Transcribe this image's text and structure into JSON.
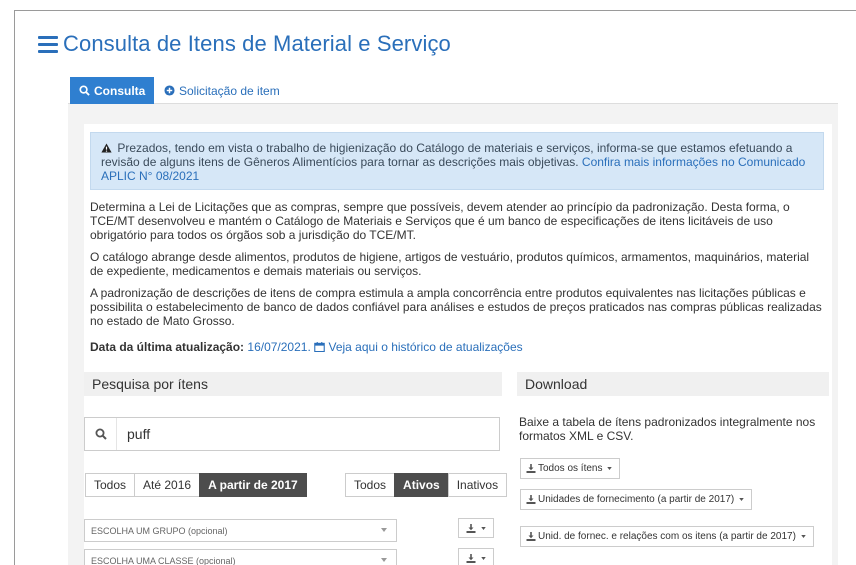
{
  "page": {
    "title": "Consulta de Itens de Material e Serviço"
  },
  "tabs": [
    {
      "label": "Consulta",
      "icon": "search-icon",
      "active": true
    },
    {
      "label": "Solicitação de item",
      "icon": "plus-circle-icon",
      "active": false
    }
  ],
  "alert": {
    "text": "Prezados, tendo em vista o trabalho de higienização do Catálogo de materiais e serviços, informa-se que estamos efetuando a revisão de alguns itens de Gêneros Alimentícios para tornar as descrições mais objetivas.",
    "link": "Confira mais informações no Comunicado APLIC N° 08/2021",
    "icon": "warning-icon"
  },
  "paragraphs": [
    "Determina a Lei de Licitações que as compras, sempre que possíveis, devem atender ao princípio da padronização. Desta forma, o TCE/MT desenvolveu e mantém o Catálogo de Materiais e Serviços que é um banco de especificações de itens licitáveis de uso obrigatório para todos os órgãos sob a jurisdição do TCE/MT.",
    "O catálogo abrange desde alimentos, produtos de higiene, artigos de vestuário, produtos químicos, armamentos, maquinários, material de expediente, medicamentos e demais materiais ou serviços.",
    "A padronização de descrições de itens de compra estimula a ampla concorrência entre produtos equivalentes nas licitações públicas e possibilita o estabelecimento de banco de dados confiável para análises e estudos de preços praticados nas compras públicas realizadas no estado de Mato Grosso."
  ],
  "update": {
    "label": "Data da última atualização:",
    "date": "16/07/2021.",
    "history_link": "Veja aqui o histórico de atualizações"
  },
  "search": {
    "heading": "Pesquisa por ítens",
    "value": "puff",
    "year_filters": [
      {
        "label": "Todos",
        "active": false
      },
      {
        "label": "Até 2016",
        "active": false
      },
      {
        "label": "A partir de 2017",
        "active": true
      }
    ],
    "status_filters": [
      {
        "label": "Todos",
        "active": false
      },
      {
        "label": "Ativos",
        "active": true
      },
      {
        "label": "Inativos",
        "active": false
      }
    ],
    "group_select": "ESCOLHA UM GRUPO (opcional)",
    "class_select": "ESCOLHA UMA CLASSE (opcional)"
  },
  "download": {
    "heading": "Download",
    "description": "Baixe a tabela de ítens padronizados integralmente nos formatos XML e CSV.",
    "buttons": [
      "Todos os ítens",
      "Unidades de fornecimento (a partir de 2017)",
      "Unid. de fornec. e relações com os itens (a partir de 2017)"
    ]
  },
  "colors": {
    "accent": "#2a6fba",
    "tab_active": "#2f7fd0",
    "alert_bg": "#d6e7f7",
    "toggle_on": "#4d4d4d"
  }
}
